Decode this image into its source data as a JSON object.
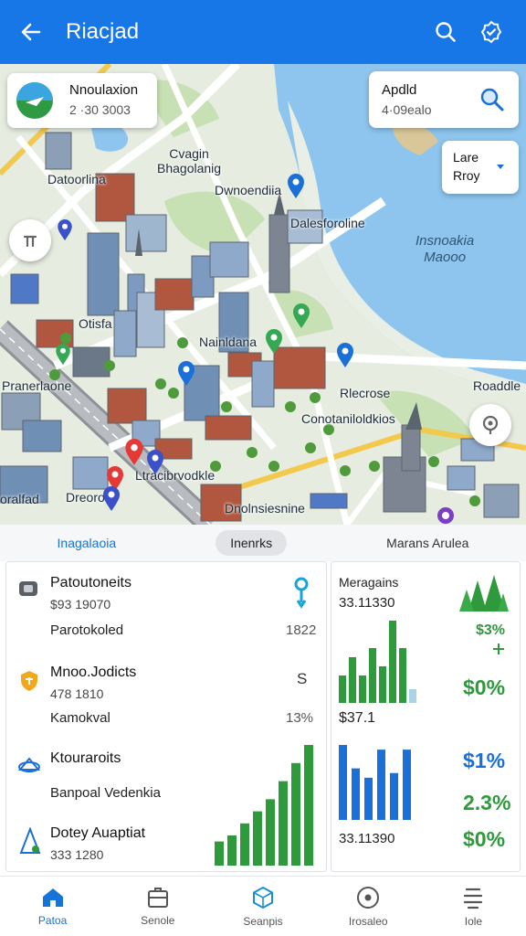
{
  "header": {
    "title": "Riacjad"
  },
  "map": {
    "location_card": {
      "title": "Nnoulaxion",
      "subtitle": "2 ·30  3003"
    },
    "search_card": {
      "title": "Apdld",
      "subtitle": "4·09ealo"
    },
    "layer_card": {
      "line1": "Lare",
      "line2": "Rroy"
    },
    "labels": {
      "l1": "Datoorlina",
      "l2": "Cvagin\nBhagolanig",
      "l3": "Dwnoendiia",
      "l4": "Dalesforoline",
      "l5": "Insnoakia\nMaooo",
      "l6": "Otisfa",
      "l7": "Nainldana",
      "l8": "Pranerlaone",
      "l9": "Rlecrose",
      "l10": "Roaddle",
      "l11": "Conotaniloldkios",
      "l12": "Ltracibrvodkle",
      "l13": "Dreorodl",
      "l14": "Dnolnsiesnine",
      "l15": "oralfad"
    }
  },
  "tabs": [
    {
      "label": "Inagalaoia"
    },
    {
      "label": "Inenrks"
    },
    {
      "label": "Marans Arulea"
    }
  ],
  "left_panel": {
    "rows": [
      {
        "title": "Patoutoneits",
        "sub": "$93 19070",
        "label": "Parotokoled",
        "value": "1822"
      },
      {
        "title": "Mnoo.Jodicts",
        "sub": "478 1810",
        "label": "Kamokval",
        "value": "13%",
        "badge": "S"
      },
      {
        "title": "Ktouraroits",
        "label": "Banpoal Vedenkia"
      },
      {
        "title": "Dotey Auaptiat",
        "sub": "333 1280"
      }
    ]
  },
  "right_panel": {
    "title": "Meragains",
    "value1": "33.11330",
    "value2": "$37.1",
    "value3": "33.11390",
    "pcts": [
      "$3%",
      "$0%",
      "$1%",
      "2.3%",
      "$0%"
    ]
  },
  "chart_data": [
    {
      "type": "bar",
      "name": "left-panel-chart",
      "values": [
        2,
        2.5,
        3.5,
        4.5,
        5.5,
        7,
        8.5,
        10
      ],
      "accent": "#2e9a3b"
    },
    {
      "type": "bar",
      "name": "right-top-chart",
      "values": [
        3,
        5,
        3,
        6,
        4,
        9,
        6,
        1.5
      ],
      "accent": "#2e9a3b"
    },
    {
      "type": "bar",
      "name": "right-bottom-chart",
      "values": [
        8,
        5.5,
        4.5,
        7.5,
        5,
        7.5
      ],
      "accent": "#1a6fd8"
    }
  ],
  "bottom_nav": [
    {
      "label": "Patoa",
      "icon": "home-icon"
    },
    {
      "label": "Senole",
      "icon": "inbox-icon"
    },
    {
      "label": "Seanpis",
      "icon": "cube-icon"
    },
    {
      "label": "Irosaleo",
      "icon": "target-icon"
    },
    {
      "label": "Iole",
      "icon": "list-icon"
    }
  ],
  "colors": {
    "primary": "#1877e6",
    "green": "#2e9a3b",
    "blue": "#1a6fd8"
  }
}
